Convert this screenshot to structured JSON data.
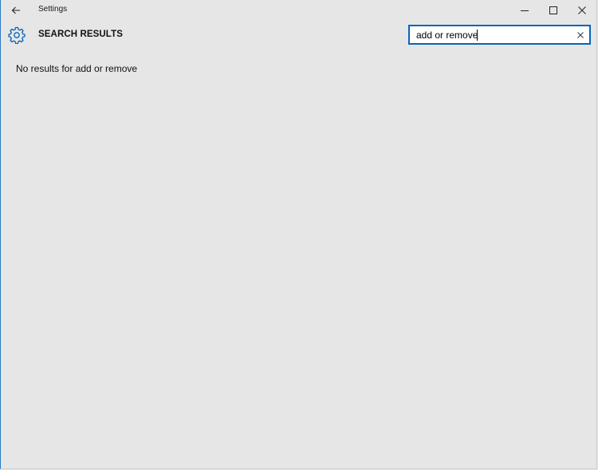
{
  "window": {
    "title": "Settings",
    "accent_color": "#0a64b8",
    "background_color": "#e6e6e6"
  },
  "header": {
    "page_title": "SEARCH RESULTS"
  },
  "search": {
    "value": "add or remove",
    "placeholder": ""
  },
  "main": {
    "message": "No results for add or remove"
  },
  "icons": {
    "back": "back-arrow-icon",
    "settings": "gear-icon",
    "minimize": "minimize-icon",
    "maximize": "maximize-icon",
    "close": "close-icon",
    "clear": "clear-search-icon"
  }
}
